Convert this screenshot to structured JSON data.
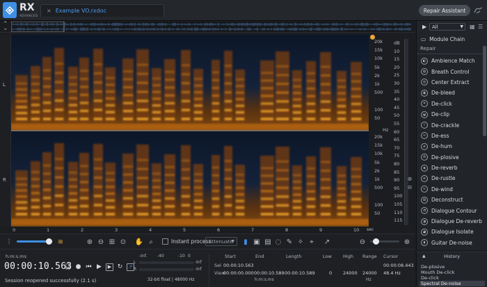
{
  "app": {
    "logo_text": "RX",
    "logo_sub": "ADVANCED"
  },
  "tab": {
    "close": "×",
    "filename": "Example VO.rxdoc"
  },
  "header": {
    "repair_assistant": "Repair Assistant"
  },
  "channels": {
    "left": "L",
    "right": "R"
  },
  "hz_scale": [
    "20k",
    "15k",
    "10k",
    "5k",
    "2k",
    "1k",
    "500",
    "",
    "100",
    "50",
    "",
    "20k",
    "15k",
    "10k",
    "5k",
    "2k",
    "1k",
    "500",
    "",
    "100",
    "50"
  ],
  "hz_unit": "Hz",
  "db_scale": [
    "dB",
    "10",
    "15",
    "20",
    "25",
    "30",
    "35",
    "40",
    "45",
    "50",
    "55",
    "60",
    "65",
    "70",
    "75",
    "80",
    "85",
    "90",
    "95",
    "100",
    "105",
    "110",
    "115"
  ],
  "time_ticks": [
    "0",
    "1",
    "2",
    "3",
    "4",
    "5",
    "6",
    "7",
    "8",
    "9",
    "10"
  ],
  "time_unit": "sec",
  "toolbar": {
    "instant_process": "Instant process",
    "attenuate": "Attenuate"
  },
  "transport": {
    "format": "h:m:s.ms",
    "time": "00:00:10.563",
    "status": "Session reopened successfully (2.1 s)"
  },
  "meters": {
    "labels": [
      "-Inf.",
      "-40",
      "-10",
      "0"
    ],
    "ch_l": "L",
    "ch_r": "R",
    "inf_l": "-Inf",
    "inf_r": "-Inf",
    "format": "32-bit float | 48000 Hz"
  },
  "selection": {
    "headers": [
      "Start",
      "End",
      "Length",
      "Low",
      "High",
      "Range",
      "Cursor"
    ],
    "sel_label": "Sel",
    "view_label": "View",
    "sel_start": "00:00:10.563",
    "view_start": "00:00:00.000",
    "view_end": "00:00:10.589",
    "view_length": "00:00:10.589",
    "low": "0",
    "high": "24000",
    "range": "24000",
    "cursor_time": "00:00:08.443",
    "cursor_hz": "48.4 Hz",
    "hms_unit": "h:m:s.ms",
    "hz_unit": "Hz"
  },
  "panel": {
    "filter": "All",
    "module_chain": "Module Chain",
    "section": "Repair",
    "modules": [
      "Ambience Match",
      "Breath Control",
      "Center Extract",
      "De-bleed",
      "De-click",
      "De-clip",
      "De-crackle",
      "De-ess",
      "De-hum",
      "De-plosive",
      "De-reverb",
      "De-rustle",
      "De-wind",
      "Deconstruct",
      "Dialogue Contour",
      "Dialogue De-reverb",
      "Dialogue Isolate",
      "Guitar De-noise"
    ]
  },
  "history": {
    "title": "History",
    "items": [
      "De-plosive",
      "Mouth De-click",
      "De-click",
      "Spectral De-noise"
    ]
  },
  "colors": {
    "accent": "#3e8fe6",
    "spectrum_hot": "#f5a623",
    "spectrum_bg": "#0d1a2e"
  }
}
